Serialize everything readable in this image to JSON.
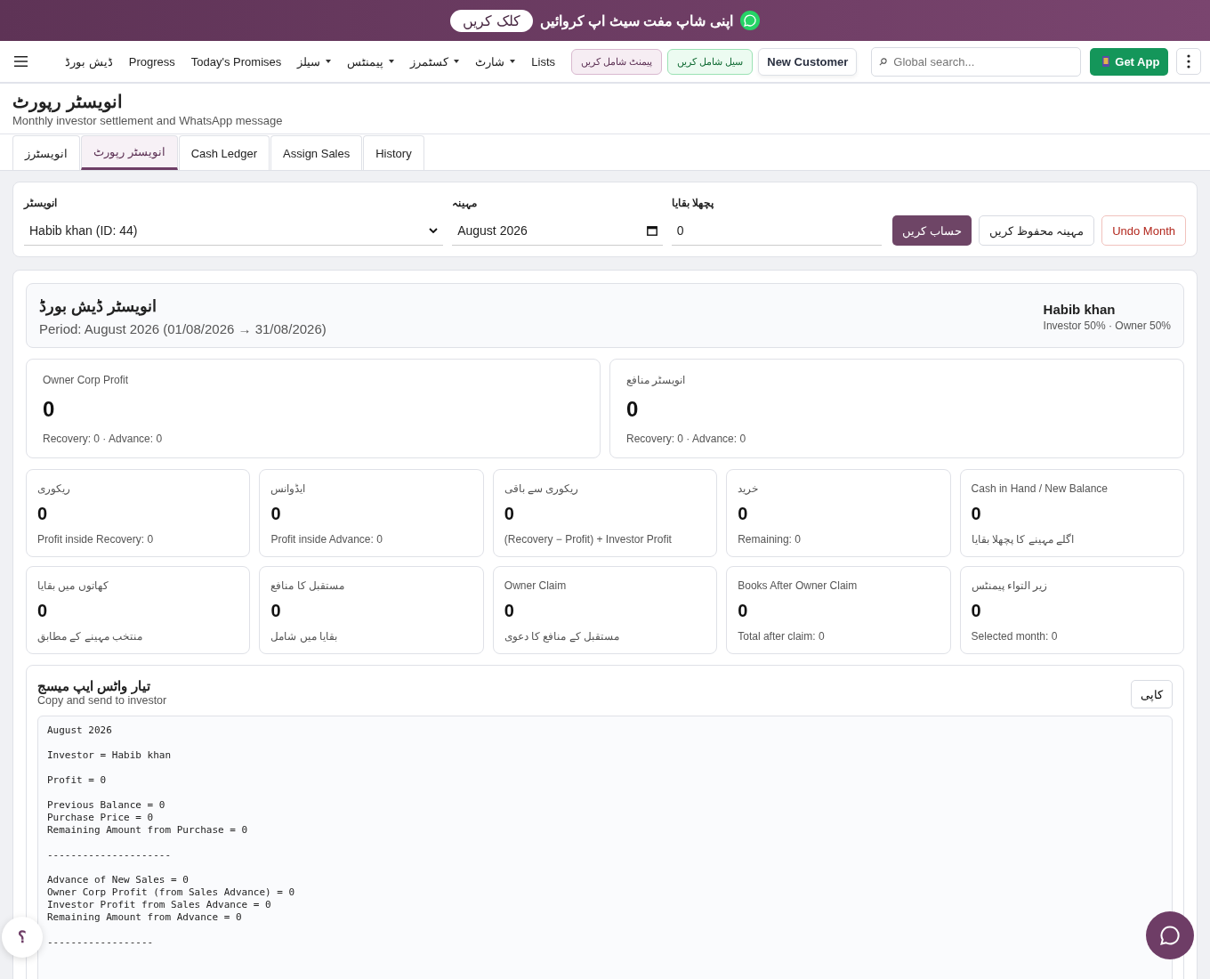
{
  "promo_banner": {
    "text": "اپنی شاپ مفت سیٹ اپ کروائیں",
    "button": "کلک کریں"
  },
  "nav": {
    "items": [
      {
        "label": "Lists",
        "has_menu": false
      },
      {
        "label": "شارٹ",
        "has_menu": true
      },
      {
        "label": "کسٹمرز",
        "has_menu": true
      },
      {
        "label": "پیمنٹس",
        "has_menu": true
      },
      {
        "label": "سیلز",
        "has_menu": true
      },
      {
        "label": "Today's Promises",
        "has_menu": false
      },
      {
        "label": "Progress",
        "has_menu": false
      },
      {
        "label": "ڈیش بورڈ",
        "has_menu": false
      }
    ],
    "actions": [
      {
        "label": "New Customer",
        "kind": "plain"
      },
      {
        "label": "سیل شامل کریں",
        "kind": "sale"
      },
      {
        "label": "پیمنٹ شامل کریں",
        "kind": "payment"
      }
    ],
    "search": {
      "placeholder": "Global search..."
    },
    "get_app": "Get App"
  },
  "page": {
    "title": "انویسٹر رپورٹ",
    "subtitle": "Monthly investor settlement and WhatsApp message"
  },
  "tabs": [
    {
      "label": "History",
      "selected": false
    },
    {
      "label": "Assign Sales",
      "selected": false
    },
    {
      "label": "Cash Ledger",
      "selected": false
    },
    {
      "label": "انویسٹر رپورٹ",
      "selected": true
    },
    {
      "label": "انویسٹرز",
      "selected": false
    }
  ],
  "form": {
    "investor": {
      "label": "انویسٹر",
      "value": "Habib khan (ID: 44)"
    },
    "month": {
      "label": "مہینہ",
      "value": "August 2026"
    },
    "previous_balance": {
      "label": "پچھلا بقایا",
      "value": "0"
    },
    "buttons": [
      {
        "label": "Undo Month",
        "kind": "danger"
      },
      {
        "label": "مہینہ محفوظ کریں",
        "kind": "secondary"
      },
      {
        "label": "حساب کریں",
        "kind": "primary"
      }
    ]
  },
  "dashboard": {
    "title": "انویسٹر ڈیش بورڈ",
    "period": "Period: August 2026 (01/08/2026 → 31/08/2026)",
    "investor_name": "Habib khan",
    "shares": "Investor 50% · Owner 50%"
  },
  "main_cards": [
    {
      "label": "انویسٹر منافع",
      "value": "0",
      "note": "Recovery: 0 · Advance: 0"
    },
    {
      "label": "Owner Corp Profit",
      "value": "0",
      "note": "Recovery: 0 · Advance: 0"
    }
  ],
  "cards": [
    {
      "label": "Cash in Hand / New Balance",
      "value": "0",
      "note": "اگلے مہینے کا پچھلا بقایا"
    },
    {
      "label": "خرید",
      "value": "0",
      "note": "Remaining: 0"
    },
    {
      "label": "ریکوری سے باقی",
      "value": "0",
      "note": "(Recovery − Profit) + Investor Profit"
    },
    {
      "label": "ایڈوانس",
      "value": "0",
      "note": "Profit inside Advance: 0"
    },
    {
      "label": "ریکوری",
      "value": "0",
      "note": "Profit inside Recovery: 0"
    },
    {
      "label": "زیر التواء پیمنٹس",
      "value": "0",
      "note": "Selected month: 0"
    },
    {
      "label": "Books After Owner Claim",
      "value": "0",
      "note": "Total after claim: 0"
    },
    {
      "label": "Owner Claim",
      "value": "0",
      "note": "مستقبل کے منافع کا دعوی"
    },
    {
      "label": "مستقبل کا منافع",
      "value": "0",
      "note": "بقایا میں شامل"
    },
    {
      "label": "کھاتوں میں بقایا",
      "value": "0",
      "note": "منتخب مہینے کے مطابق"
    }
  ],
  "message": {
    "title": "تیار واٹس ایپ میسج",
    "subtitle": "Copy and send to investor",
    "copy_button": "کاپی",
    "paragraphs": [
      [
        "August 2026"
      ],
      [
        "Investor = Habib khan"
      ],
      [
        "Profit = 0"
      ],
      [
        "Previous Balance = 0",
        "Purchase Price = 0",
        "Remaining Amount from Purchase = 0"
      ],
      [
        "---------------------"
      ],
      [
        "Advance of New Sales = 0",
        "Owner Corp Profit (from Sales Advance) = 0",
        "Investor Profit from Sales Advance = 0",
        "Remaining Amount from Advance = 0"
      ],
      [
        "------------------"
      ]
    ]
  },
  "help_button": "؟"
}
